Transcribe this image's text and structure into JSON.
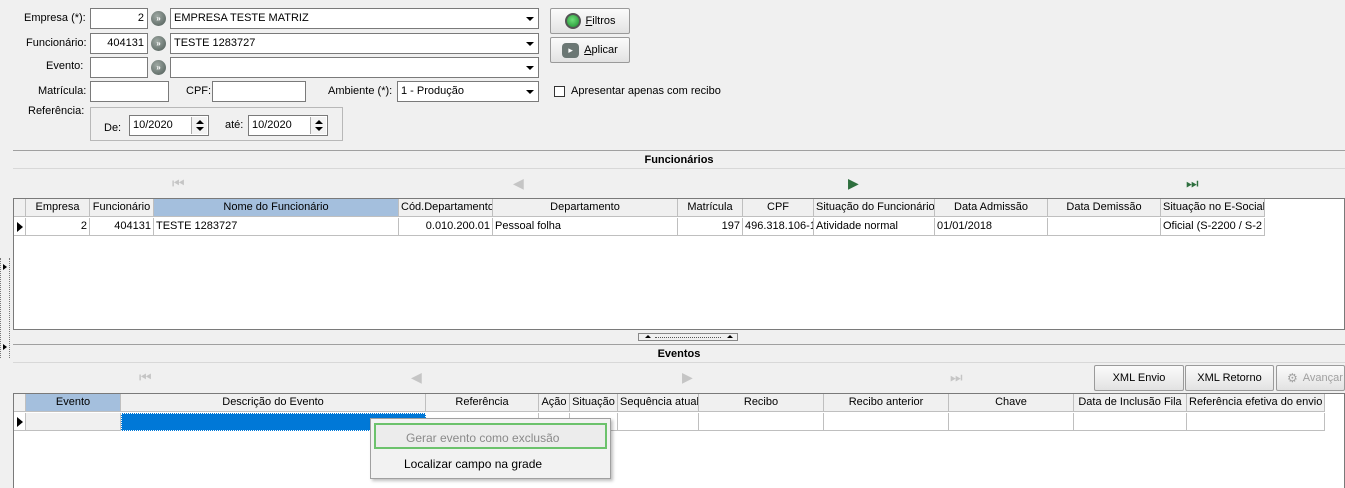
{
  "filters": {
    "empresa_label": "Empresa (*):",
    "empresa_code": "2",
    "empresa_name": "EMPRESA TESTE MATRIZ",
    "funcionario_label": "Funcionário:",
    "funcionario_code": "404131",
    "funcionario_name": "TESTE 1283727",
    "evento_label": "Evento:",
    "evento_code": "",
    "evento_name": "",
    "matricula_label": "Matrícula:",
    "matricula_value": "",
    "cpf_label": "CPF:",
    "cpf_value": "",
    "ambiente_label": "Ambiente (*):",
    "ambiente_value": "1 - Produção",
    "apenas_recibo_label": "Apresentar apenas com recibo",
    "referencia_label": "Referência:",
    "de_label": "De:",
    "de_value": "10/2020",
    "ate_label": "até:",
    "ate_value": "10/2020"
  },
  "buttons": {
    "filtros": "iltros",
    "filtros_underline": "F",
    "aplicar": "plicar",
    "aplicar_underline": "A"
  },
  "funcionarios": {
    "title": "Funcionários",
    "columns": [
      "Empresa",
      "Funcionário",
      "Nome do Funcionário",
      "Cód.Departamento",
      "Departamento",
      "Matrícula",
      "CPF",
      "Situação do Funcionário",
      "Data Admissão",
      "Data Demissão",
      "Situação no E-Social"
    ],
    "rows": [
      [
        "2",
        "404131",
        "TESTE 1283727",
        "0.010.200.01",
        "Pessoal folha",
        "197",
        "496.318.106-1",
        "Atividade normal",
        "01/01/2018",
        "",
        "Oficial (S-2200 / S-2"
      ]
    ]
  },
  "eventos": {
    "title": "Eventos",
    "xml_envio": "XML Envio",
    "xml_retorno": "XML Retorno",
    "avancar": "Avançar",
    "columns": [
      "Evento",
      "Descrição do Evento",
      "Referência",
      "Ação",
      "Situação",
      "Sequência atual",
      "Recibo",
      "Recibo anterior",
      "Chave",
      "Data de Inclusão Fila",
      "Referência efetiva do envio"
    ]
  },
  "context_menu": {
    "items": [
      "Gerar evento como exclusão",
      "Localizar campo na grade"
    ]
  },
  "colors": {
    "header_selected": "#a4bfdd",
    "selection_blue": "#0078d7",
    "highlight_green": "#6cc26c",
    "nav_green": "#2e6f3e"
  }
}
